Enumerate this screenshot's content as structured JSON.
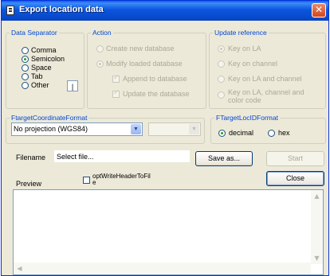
{
  "window": {
    "title": "Export location data",
    "close_glyph": "✕"
  },
  "separator": {
    "legend": "Data Separator",
    "options": [
      "Comma",
      "Semicolon",
      "Space",
      "Tab",
      "Other"
    ],
    "selected": "Semicolon",
    "other_value": "|"
  },
  "action": {
    "legend": "Action",
    "create_label": "Create new database",
    "modify_label": "Modify loaded database",
    "append_label": "Append to database",
    "update_label": "Update the database"
  },
  "update_ref": {
    "legend": "Update reference",
    "options": [
      "Key on LA",
      "Key on channel",
      "Key on LA and channel",
      "Key on LA, channel and",
      "color code"
    ]
  },
  "coord": {
    "legend": "FtargetCoordinateFormat",
    "projection_value": "No projection (WGS84)",
    "second_value": ""
  },
  "locid": {
    "legend": "FTargetLocIDFormat",
    "decimal_label": "decimal",
    "hex_label": "hex",
    "selected": "decimal"
  },
  "file": {
    "filename_label": "Filename",
    "filename_value": "Select file...",
    "save_as_label": "Save as...",
    "start_label": "Start",
    "close_label": "Close",
    "header_option_label_line1": "optWriteHeaderToFil",
    "header_option_label_line2": "e",
    "preview_label": "Preview"
  },
  "preview": {
    "content": ""
  },
  "icons": {
    "app": "app-icon",
    "dropdown": "▼",
    "scroll_up": "▲",
    "scroll_down": "▼",
    "scroll_left": "◀"
  }
}
